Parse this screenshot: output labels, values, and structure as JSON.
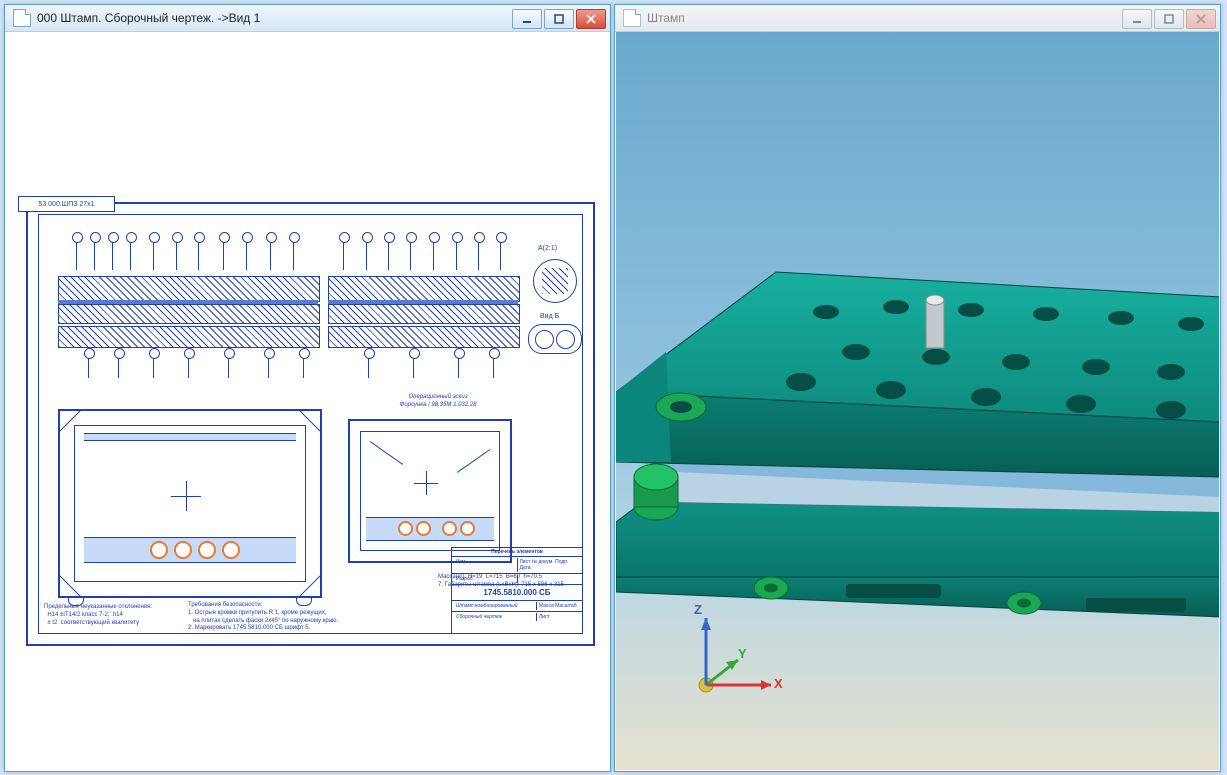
{
  "windows": {
    "drawing": {
      "title": "000 Штамп. Сборочный чертеж. ->Вид 1",
      "sheet_code": "53 000.ШПЗ 27x1",
      "section_text": "Операционный эскиз\nФорсунка / 98.35М 1.032.28",
      "detail_label_A": "А(2:1)",
      "detail_label_B": "Вид Б",
      "notes_left": "Предельные неуказанные отклонения:\n  Н14 ±IT14/2 класс 7-2;  h14\n  ± t2  соответствующий квалитету",
      "notes_center": "Требования безопасности:\n1. Острые кромки притупить R 1, кроме режущих,\n   на плитах сделать фаски 2x45° по наружному краю.\n2. Маркировать 1745.5810.000 СБ шрифт 5.",
      "notes_right": "Масса(кг): H=19  L=715  B=60  h=70.5\n7. Габариты штампа (LxBxH): 715 x 586 x 315",
      "titleblock": {
        "header": "Перечень элементов",
        "row1a": "Изм.",
        "row1b": "Лист  № докум.  Подп.  Дата",
        "row2a": "Разраб.",
        "row2b": "",
        "code": "1745.5810.000 СБ",
        "name_line1": "Штамп комбинированный",
        "name_line2": "Сборочный чертеж",
        "footer_l": "Лист",
        "footer_r": "Масса  Масштаб"
      }
    },
    "model": {
      "title": "Штамп",
      "axes": {
        "x": "X",
        "y": "Y",
        "z": "Z"
      }
    }
  },
  "colors": {
    "drawing_line": "#2040b0",
    "accent": "#ea7a2e",
    "model_teal": "#0f9b8e",
    "model_green": "#1aa756",
    "model_blue": "#7ab7e0",
    "model_grey": "#c3c8cc",
    "axis_x": "#d33",
    "axis_y": "#3a3",
    "axis_z": "#36c",
    "origin": "#d9c23a"
  }
}
